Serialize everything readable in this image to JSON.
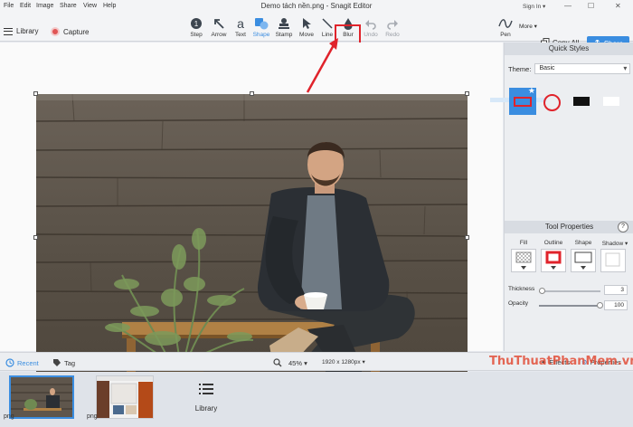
{
  "menu": [
    "File",
    "Edit",
    "Image",
    "Share",
    "View",
    "Help"
  ],
  "window_title": "Demo tách nền.png - Snagit Editor",
  "account": {
    "signin": "Sign In ▾"
  },
  "toolbar": {
    "library_label": "Library",
    "capture_label": "Capture",
    "tools": [
      {
        "label": "Step",
        "icon": "step-icon"
      },
      {
        "label": "Arrow",
        "icon": "arrow-icon"
      },
      {
        "label": "Text",
        "icon": "text-icon"
      },
      {
        "label": "Shape",
        "icon": "shape-icon"
      },
      {
        "label": "Stamp",
        "icon": "stamp-icon"
      },
      {
        "label": "Move",
        "icon": "move-icon"
      },
      {
        "label": "Line",
        "icon": "line-icon"
      },
      {
        "label": "Blur",
        "icon": "blur-drop-icon"
      },
      {
        "label": "Undo",
        "icon": "undo-icon"
      },
      {
        "label": "Redo",
        "icon": "redo-icon"
      }
    ],
    "pen_label": "Pen",
    "more_label": "More",
    "copy_all_label": "Copy All",
    "share_label": "Share"
  },
  "quick_styles": {
    "title": "Quick Styles",
    "theme_label": "Theme:",
    "theme_value": "Basic"
  },
  "tool_properties": {
    "title": "Tool Properties",
    "help": "?",
    "props": [
      "Fill",
      "Outline",
      "Shape",
      "Shadow ▾"
    ],
    "thickness_label": "Thickness",
    "thickness_value": "3",
    "opacity_label": "Opacity",
    "opacity_value": "100"
  },
  "bottom_bar": {
    "recent": "Recent",
    "tag": "Tag",
    "zoom": "45% ▾",
    "dimensions": "1920 x 1280px ▾",
    "effects": "Effects",
    "properties": "Properties"
  },
  "tray": {
    "items": [
      {
        "label": "png"
      },
      {
        "label": "png"
      }
    ],
    "library_label": "Library"
  },
  "watermark": "ThuThuatPhanMem.vn",
  "colors": {
    "accent": "#3a8de0",
    "highlight_red": "#e0232b"
  }
}
